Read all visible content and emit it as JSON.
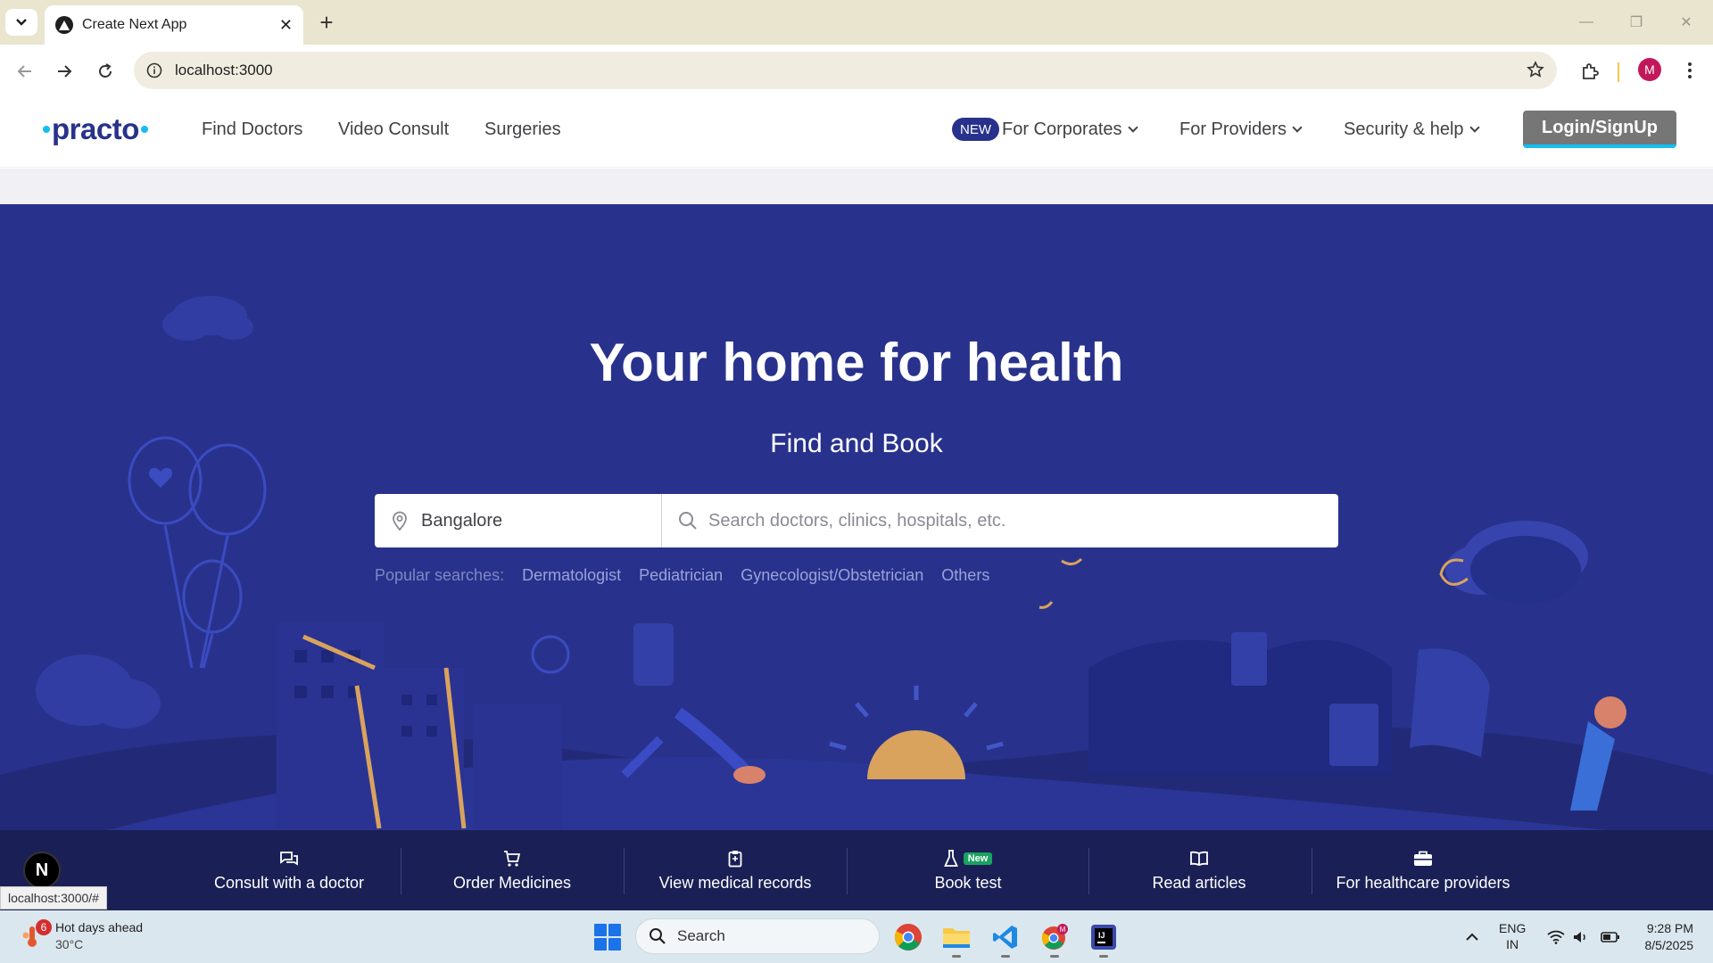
{
  "browser": {
    "tab_title": "Create Next App",
    "url": "localhost:3000",
    "profile_initial": "M",
    "status_url": "localhost:3000/#"
  },
  "header": {
    "logo": "practo",
    "nav": [
      "Find Doctors",
      "Video Consult",
      "Surgeries"
    ],
    "new_badge": "NEW",
    "dropdowns": [
      "For Corporates",
      "For Providers",
      "Security & help"
    ],
    "login_label": "Login/SignUp"
  },
  "hero": {
    "title": "Your home for health",
    "subtitle": "Find and Book",
    "location_value": "Bangalore",
    "search_placeholder": "Search doctors, clinics, hospitals, etc.",
    "popular_label": "Popular searches:",
    "popular_items": [
      "Dermatologist",
      "Pediatrician",
      "Gynecologist/Obstetrician",
      "Others"
    ]
  },
  "categories": [
    {
      "label": "Consult with a doctor",
      "icon": "chat-icon"
    },
    {
      "label": "Order Medicines",
      "icon": "cart-icon"
    },
    {
      "label": "View medical records",
      "icon": "clipboard-icon"
    },
    {
      "label": "Book test",
      "icon": "flask-icon",
      "badge": "New"
    },
    {
      "label": "Read articles",
      "icon": "book-icon"
    },
    {
      "label": "For healthcare providers",
      "icon": "briefcase-icon"
    }
  ],
  "next_badge": "N",
  "taskbar": {
    "weather_count": "6",
    "weather_title": "Hot days ahead",
    "weather_temp": "30°C",
    "search_label": "Search",
    "lang_line1": "ENG",
    "lang_line2": "IN",
    "time": "9:28 PM",
    "date": "8/5/2025"
  },
  "colors": {
    "brand_navy": "#28328c",
    "brand_cyan": "#14bef0",
    "category_bar": "#1a2055"
  }
}
